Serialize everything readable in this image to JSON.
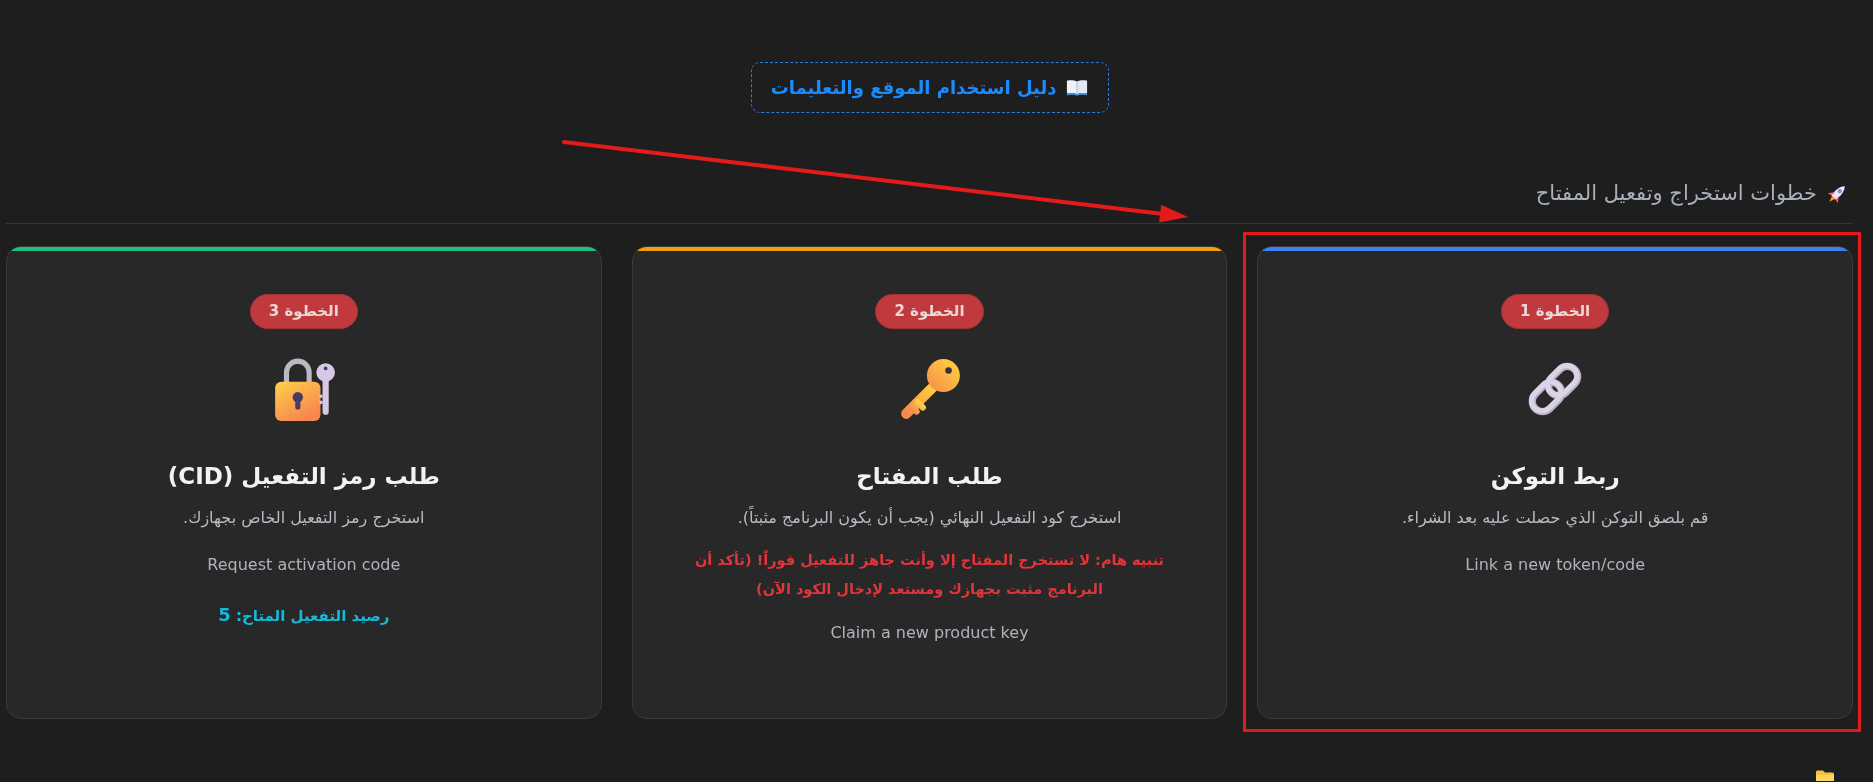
{
  "guide_button": {
    "label": "دليل استخدام الموقع والتعليمات"
  },
  "section": {
    "title": "خطوات استخراج وتفعيل المفتاح"
  },
  "steps": [
    {
      "kind": "token",
      "badge": "الخطوة 1",
      "title": "ربط التوكن",
      "description": "قم بلصق التوكن الذي حصلت عليه بعد الشراء.",
      "action": "Link a new token/code",
      "color": "#3b82f6",
      "highlighted": true
    },
    {
      "kind": "key",
      "badge": "الخطوة 2",
      "title": "طلب المفتاح",
      "description": "استخرج كود التفعيل النهائي (يجب أن يكون البرنامج مثبتاً).",
      "warning": "تنبيه هام: لا تستخرج المفتاح إلا وأنت جاهز للتفعيل فوراً! (تأكد أن البرنامج مثبت بجهازك ومستعد لإدخال الكود الآن)",
      "action": "Claim a new product key",
      "color": "#f59e0b",
      "highlighted": false
    },
    {
      "kind": "activation",
      "badge": "الخطوة 3",
      "title": "طلب رمز التفعيل (CID)",
      "description": "استخرج رمز التفعيل الخاص بجهازك.",
      "action": "Request activation code",
      "balance": "رصيد التفعيل المتاح: **5**",
      "color": "#1fbf7f",
      "highlighted": false
    }
  ],
  "annotations": [
    {
      "kind": "arrow"
    }
  ]
}
